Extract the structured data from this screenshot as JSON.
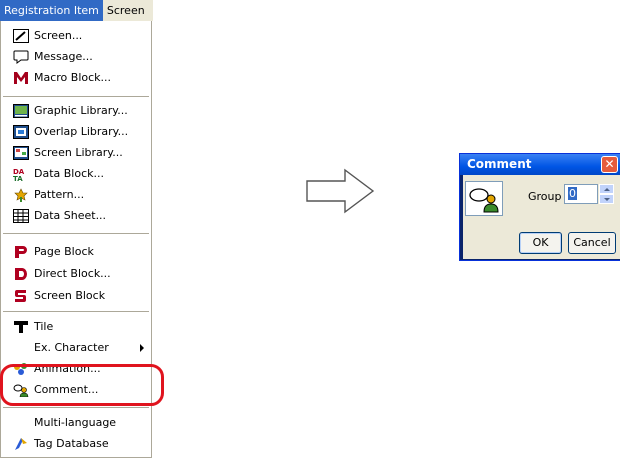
{
  "menubar": {
    "items": [
      {
        "label": "Registration Item",
        "active": true
      },
      {
        "label": "Screen",
        "active": false
      }
    ]
  },
  "menu": {
    "items": [
      {
        "label": "Screen...",
        "icon": "screen-edit-icon"
      },
      {
        "label": "Message...",
        "icon": "message-bubble-icon"
      },
      {
        "label": "Macro Block...",
        "icon": "macro-m-icon"
      },
      {
        "label": "Graphic Library...",
        "icon": "graphic-library-icon"
      },
      {
        "label": "Overlap Library...",
        "icon": "overlap-library-icon"
      },
      {
        "label": "Screen Library...",
        "icon": "screen-library-icon"
      },
      {
        "label": "Data Block...",
        "icon": "data-block-icon"
      },
      {
        "label": "Pattern...",
        "icon": "pattern-icon"
      },
      {
        "label": "Data Sheet...",
        "icon": "data-sheet-icon"
      },
      {
        "label": "Page Block",
        "icon": "page-block-icon"
      },
      {
        "label": "Direct Block...",
        "icon": "direct-block-icon"
      },
      {
        "label": "Screen Block",
        "icon": "screen-block-icon"
      },
      {
        "label": "Tile",
        "icon": "tile-icon"
      },
      {
        "label": "Ex. Character",
        "icon": "",
        "submenu": true
      },
      {
        "label": "Animation...",
        "icon": "animation-icon"
      },
      {
        "label": "Comment...",
        "icon": "comment-icon"
      },
      {
        "label": "Multi-language",
        "icon": ""
      },
      {
        "label": "Tag Database",
        "icon": "tag-database-icon"
      }
    ]
  },
  "dialog": {
    "title": "Comment",
    "group_label": "Group",
    "group_value": "0",
    "ok_label": "OK",
    "cancel_label": "Cancel"
  },
  "colors": {
    "highlight": "#e0141e",
    "menu_active": "#316ac5",
    "titlebar": "#0055e5"
  }
}
